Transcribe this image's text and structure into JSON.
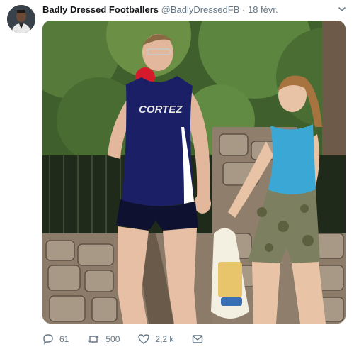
{
  "tweet": {
    "author_name": "Badly Dressed Footballers",
    "handle": "@BadlyDressedFB",
    "separator": "·",
    "date": "18 févr.",
    "image": {
      "shirt_text": "CORTEZ"
    },
    "actions": {
      "replies": "61",
      "retweets": "500",
      "likes": "2,2 k"
    }
  }
}
